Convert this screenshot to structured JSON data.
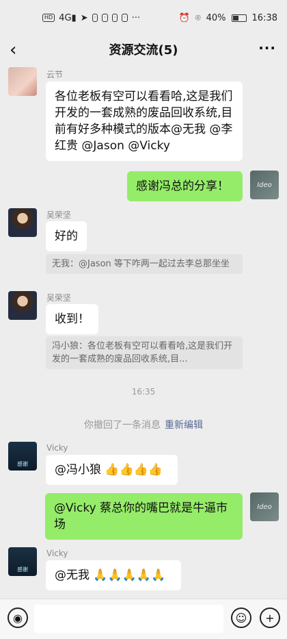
{
  "status_bar": {
    "left_icons": [
      "HD",
      "4G",
      "signal",
      "send",
      "app1",
      "app2",
      "app3",
      "app4",
      "..."
    ],
    "battery": "40%",
    "time": "16:38"
  },
  "header": {
    "title": "资源交流(5)",
    "more": "···"
  },
  "messages": [
    {
      "sender": "云节",
      "text": "各位老板有空可以看看哈,这是我们开发的一套成熟的废品回收系统,目前有好多种模式的版本@无我 @李红贵 @Jason @Vicky"
    },
    {
      "text": "感谢冯总的分享！"
    },
    {
      "sender": "吴荣坚",
      "text": "好的",
      "quote": "无我：@Jason 等下咋两一起过去李总那坐坐"
    },
    {
      "sender": "吴荣坚",
      "text": "收到！",
      "quote": "冯小狼：各位老板有空可以看看哈,这是我们开发的一套成熟的废品回收系统,目..."
    },
    {
      "sender": "Vicky",
      "text": "@冯小狼 👍👍👍👍"
    },
    {
      "text": "@Vicky 蔡总你的嘴巴就是牛逼市场"
    },
    {
      "sender": "Vicky",
      "text": "@无我 🙏🙏🙏🙏🙏"
    }
  ],
  "timestamp": "16:35",
  "system_notice": {
    "text": "你撤回了一条消息",
    "action": "重新编辑"
  },
  "colors": {
    "background": "#ededed",
    "self_bubble": "#95ec69",
    "link": "#576b95"
  }
}
